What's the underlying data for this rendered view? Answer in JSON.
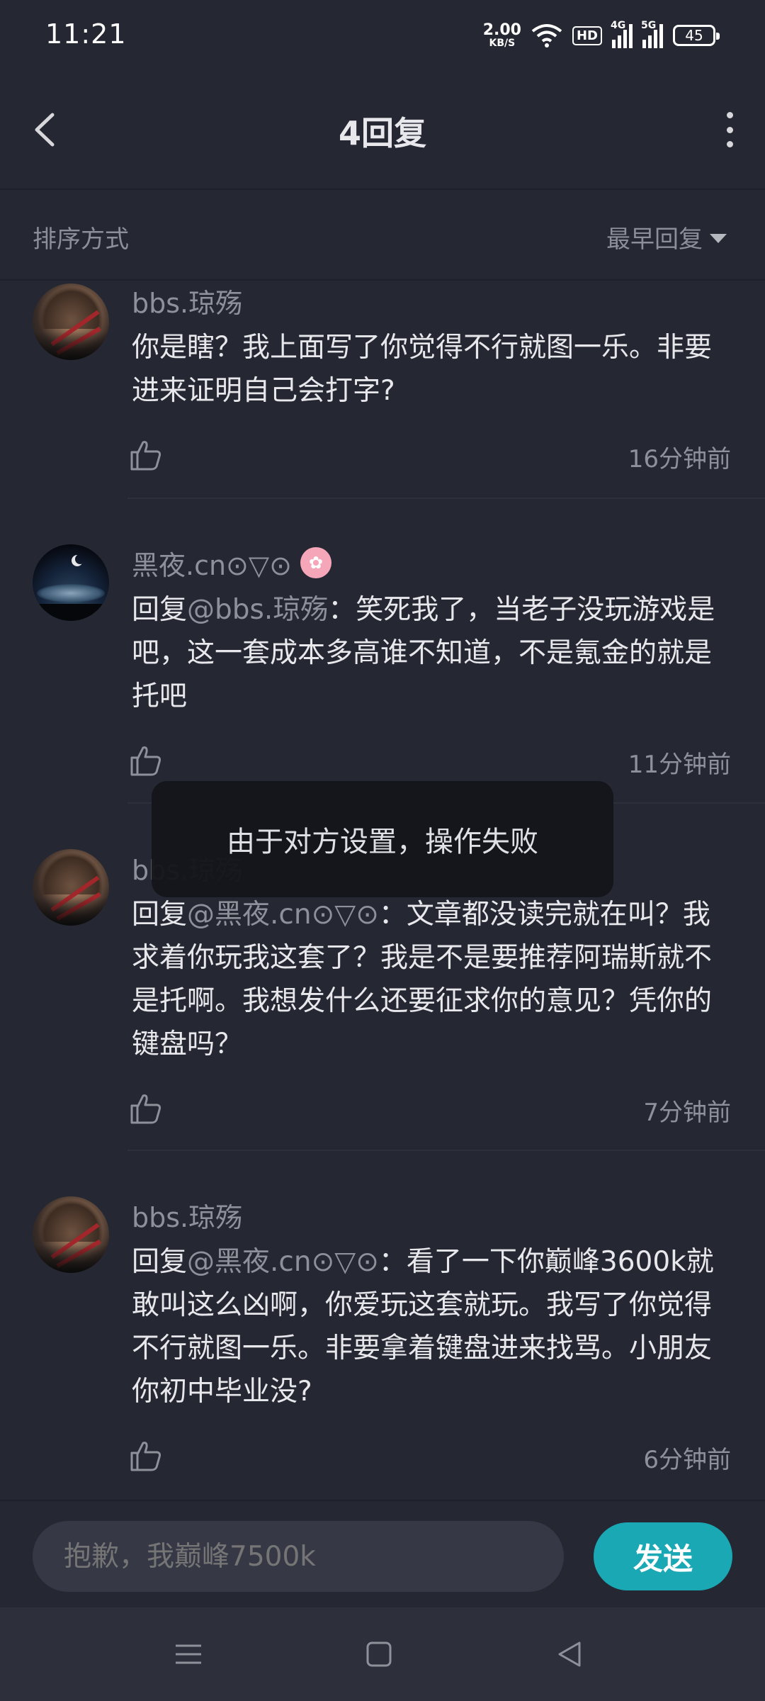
{
  "status_bar": {
    "time": "11:21",
    "net_speed": "2.00",
    "net_unit": "KB/S",
    "hd": "HD",
    "sim1": "4G",
    "sim2": "5G",
    "battery": "45"
  },
  "header": {
    "title": "4回复"
  },
  "sort": {
    "label": "排序方式",
    "value": "最早回复"
  },
  "replies": [
    {
      "name": "bbs.琼殇",
      "prefix": "",
      "mention": "",
      "text": "你是瞎？我上面写了你觉得不行就图一乐。非要进来证明自己会打字?",
      "time": "16分钟前"
    },
    {
      "name": "黑夜.cn⊙▽⊙",
      "prefix": "回复",
      "mention": "@bbs.琼殇",
      "text": "：笑死我了，当老子没玩游戏是吧，这一套成本多高谁不知道，不是氪金的就是托吧",
      "time": "11分钟前"
    },
    {
      "name": "bbs.琼殇",
      "prefix": "回复",
      "mention": "@黑夜.cn⊙▽⊙",
      "text": "：文章都没读完就在叫？我求着你玩我这套了？我是不是要推荐阿瑞斯就不是托啊。我想发什么还要征求你的意见？凭你的键盘吗？",
      "time": "7分钟前"
    },
    {
      "name": "bbs.琼殇",
      "prefix": "回复",
      "mention": "@黑夜.cn⊙▽⊙",
      "text": "：看了一下你巅峰3600k就敢叫这么凶啊，你爱玩这套就玩。我写了你觉得不行就图一乐。非要拿着键盘进来找骂。小朋友你初中毕业没?",
      "time": "6分钟前"
    }
  ],
  "toast": "由于对方设置，操作失败",
  "input": {
    "placeholder": "抱歉，我巅峰7500k"
  },
  "send_label": "发送",
  "colors": {
    "background": "#252732",
    "accent": "#1aa8b5",
    "muted_text": "#8e909a",
    "primary_text": "#e8e8ec"
  },
  "icons": {
    "back": "chevron-left-icon",
    "more": "more-vertical-icon",
    "sort": "caret-down-icon",
    "like": "thumbs-up-icon",
    "nav_menu": "menu-icon",
    "nav_home": "home-square-icon",
    "nav_back": "back-triangle-icon"
  }
}
